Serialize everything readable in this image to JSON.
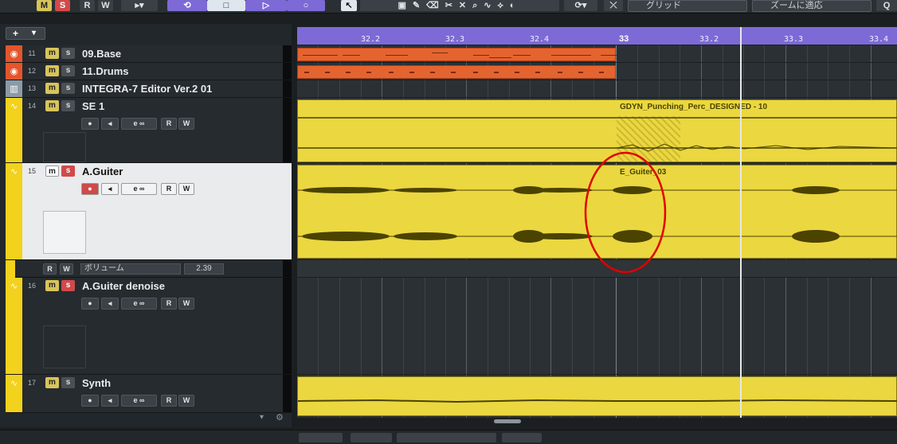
{
  "toolbar": {
    "m_label": "M",
    "s_label": "S",
    "r_label": "R",
    "w_label": "W",
    "grid_dropdown": "グリッド",
    "zoom_dropdown": "ズームに適応"
  },
  "tracklist": {
    "add_label": "+",
    "menu_label": "▾",
    "tracks": [
      {
        "num": "11",
        "name": "09.Base",
        "color": "#e4552b",
        "icon": "midi-icon"
      },
      {
        "num": "12",
        "name": "11.Drums",
        "color": "#e4552b",
        "icon": "midi-icon"
      },
      {
        "num": "13",
        "name": "INTEGRA-7 Editor Ver.2 01",
        "color": "#8c9aa6",
        "icon": "instrument-icon"
      },
      {
        "num": "14",
        "name": "SE 1",
        "color": "#f2d21c",
        "icon": "audio-icon"
      },
      {
        "num": "15",
        "name": "A.Guiter",
        "color": "#f2d21c",
        "icon": "audio-icon"
      },
      {
        "num": "16",
        "name": "A.Guiter denoise",
        "color": "#f2d21c",
        "icon": "audio-icon"
      },
      {
        "num": "17",
        "name": "Synth",
        "color": "#f2d21c",
        "icon": "audio-icon"
      }
    ],
    "automation": {
      "r": "R",
      "w": "W",
      "param": "ボリューム",
      "value": "2.39"
    }
  },
  "ruler": {
    "labels": [
      "32.2",
      "32.3",
      "32.4",
      "33",
      "33.2",
      "33.3",
      "33.4"
    ]
  },
  "events": {
    "se1": "GDYN_Punching_Perc_DESIGNED - 10",
    "aguiter": "E_Guiter_03"
  },
  "colors": {
    "accent": "#7d6ad6",
    "audio": "#ebd740",
    "midi": "#e46430",
    "annotation": "#e00000"
  }
}
